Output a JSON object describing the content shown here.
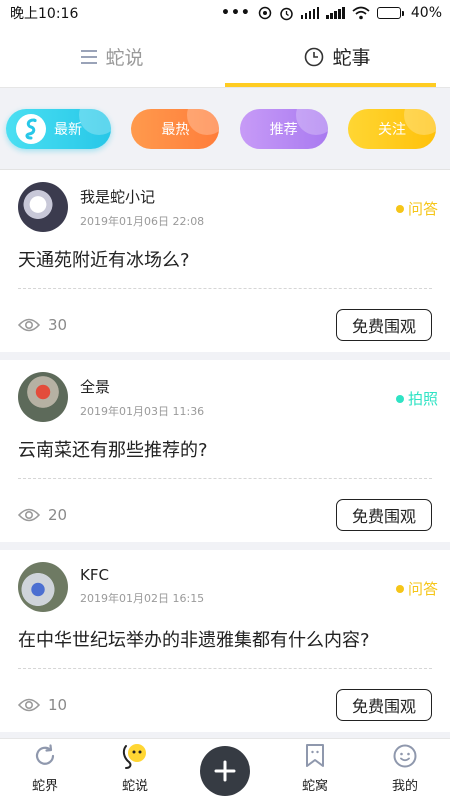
{
  "status_bar": {
    "time": "晚上10:16",
    "battery": "40%",
    "battery_level": 0.4
  },
  "top_tabs": [
    {
      "label": "蛇说",
      "icon": "menu-icon",
      "active": false
    },
    {
      "label": "蛇事",
      "icon": "clock-icon",
      "active": true
    }
  ],
  "filters": {
    "latest": "最新",
    "hot": "最热",
    "recommend": "推荐",
    "follow": "关注"
  },
  "posts": [
    {
      "author": "我是蛇小记",
      "time": "2019年01月06日 22:08",
      "tag": "问答",
      "tag_color": "#f5c518",
      "question": "天通苑附近有冰场么?",
      "views": "30",
      "button": "免费围观"
    },
    {
      "author": "全景",
      "time": "2019年01月03日 11:36",
      "tag": "拍照",
      "tag_color": "#2fe3c4",
      "question": "云南菜还有那些推荐的?",
      "views": "20",
      "button": "免费围观"
    },
    {
      "author": "KFC",
      "time": "2019年01月02日 16:15",
      "tag": "问答",
      "tag_color": "#f5c518",
      "question": "在中华世纪坛举办的非遗雅集都有什么内容?",
      "views": "10",
      "button": "免费围观"
    }
  ],
  "bottom_nav": {
    "world": "蛇界",
    "say": "蛇说",
    "nest": "蛇窝",
    "mine": "我的"
  },
  "colors": {
    "accent": "#ffcc22",
    "latest": "#27c7e8",
    "hot": "#ff7d3a",
    "recommend": "#a97af0",
    "follow": "#ffc10a"
  }
}
